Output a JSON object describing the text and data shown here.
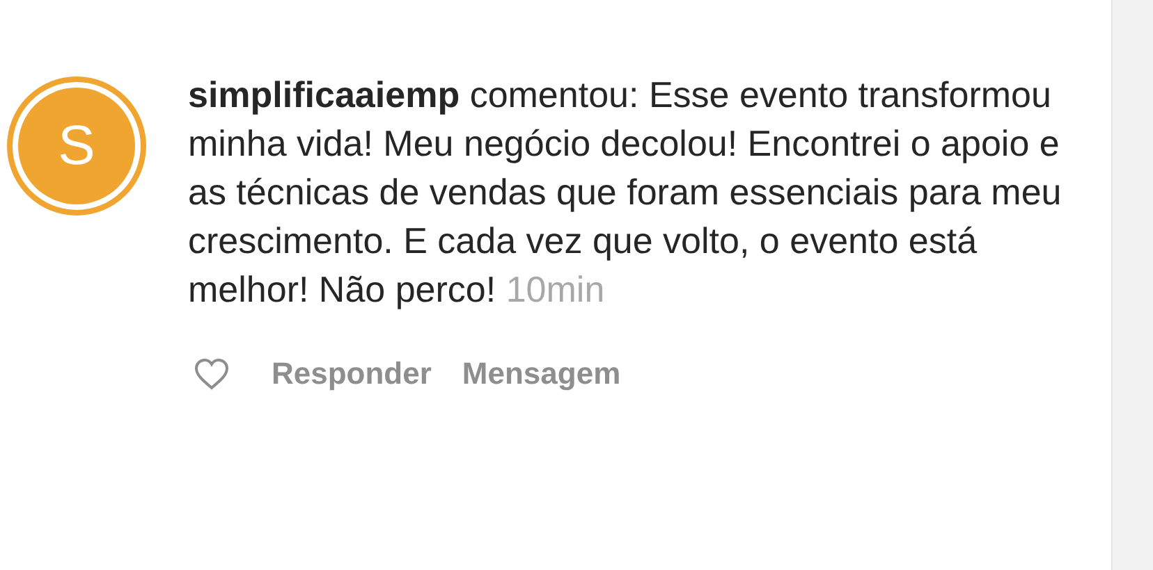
{
  "comment": {
    "avatar_letter": "S",
    "username": "simplificaaiemp",
    "text": "comentou: Esse evento transformou minha vida! Meu negócio decolou! Encontrei o apoio e as técnicas de vendas que foram essenciais para meu crescimento. E cada vez que volto, o evento está melhor! Não perco!",
    "time": "10min"
  },
  "actions": {
    "liked": false,
    "buttons": [
      "Responder",
      "Mensagem"
    ]
  }
}
